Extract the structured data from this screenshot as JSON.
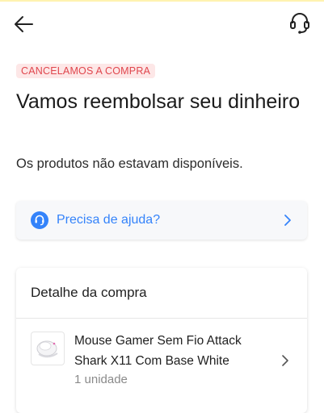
{
  "header": {
    "back_icon": "arrow-left-icon",
    "support_icon": "headset-icon"
  },
  "status": {
    "badge": "CANCELAMOS A COMPRA",
    "badge_color": "#e0464d",
    "title": "Vamos reembolsar seu dinheiro",
    "subtitle": "Os produtos não estavam disponíveis."
  },
  "help": {
    "label": "Precisa de ajuda?",
    "icon": "headset-icon",
    "chevron_icon": "chevron-right-icon",
    "accent": "#3483fa"
  },
  "purchase": {
    "title": "Detalhe da compra",
    "product": {
      "name": "Mouse Gamer Sem Fio Attack Shark X11 Com Base White",
      "quantity": "1 unidade",
      "thumbnail_icon": "mouse-product-image",
      "chevron_icon": "chevron-right-icon"
    }
  }
}
